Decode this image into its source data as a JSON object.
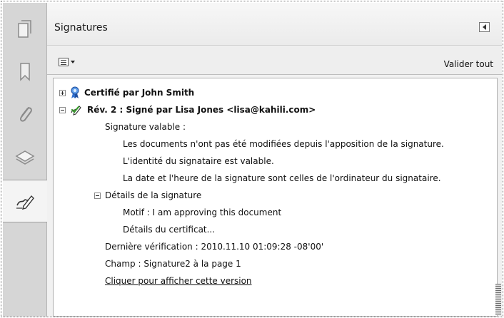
{
  "panel": {
    "title": "Signatures",
    "validate_all_label": "Valider tout"
  },
  "sidebar": {
    "items": [
      {
        "icon": "pages-icon"
      },
      {
        "icon": "bookmark-icon"
      },
      {
        "icon": "paperclip-icon"
      },
      {
        "icon": "layers-icon"
      },
      {
        "icon": "signature-pen-icon",
        "active": true
      }
    ]
  },
  "tree": {
    "certified": "Certifié par John Smith",
    "revision": "Rév. 2 : Signé par Lisa Jones <lisa@kahili.com>",
    "valid_signature": "Signature valable :",
    "not_modified": "Les documents n'ont pas été modifiées depuis l'apposition de la signature.",
    "identity_valid": "L'identité du signataire est valable.",
    "date_time": "La date et l'heure de la signature sont celles de l'ordinateur du signataire.",
    "details_heading": "Détails de la signature",
    "reason": "Motif : I am approving this document",
    "cert_details": "Détails du certificat...",
    "last_check": "Dernière vérification : 2010.11.10 01:09:28 -08'00'",
    "field": "Champ : Signature2 à la page 1",
    "view_version_link": "Cliquer pour afficher cette version"
  },
  "colors": {
    "strip_bg": "#d6d6d6",
    "panel_bg": "#f1f1f1",
    "ribbon_blue": "#2f6fcf",
    "check_green": "#3a9a2e"
  }
}
